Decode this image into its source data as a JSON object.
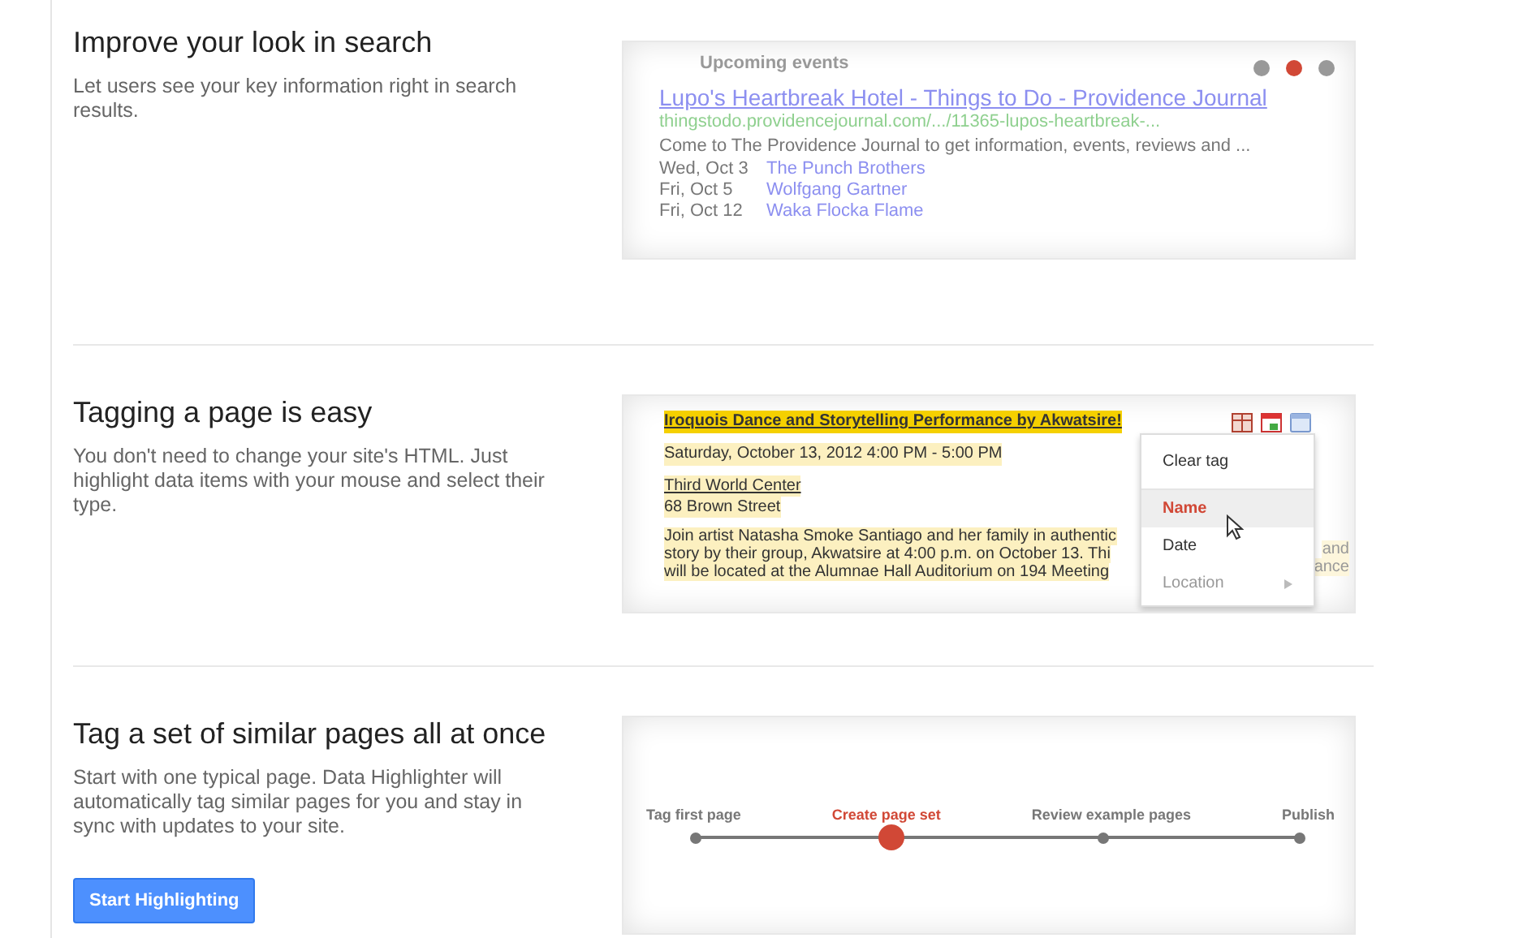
{
  "sections": [
    {
      "kind": "search",
      "heading": "Improve your look in search",
      "description": "Let users see your key information right in search results.",
      "panel": {
        "header": "Upcoming events",
        "title": "Lupo's Heartbreak Hotel - Things to Do - Providence Journal",
        "url": "thingstodo.providencejournal.com/.../11365-lupos-heartbreak-...",
        "snippet": "Come to The Providence Journal to get information, events, reviews and ...",
        "events": [
          {
            "date": "Wed, Oct 3",
            "name": "The Punch Brothers"
          },
          {
            "date": "Fri, Oct 5",
            "name": "Wolfgang Gartner"
          },
          {
            "date": "Fri, Oct 12",
            "name": "Waka Flocka Flame"
          }
        ],
        "dots": [
          {
            "selected": false
          },
          {
            "selected": true
          },
          {
            "selected": false
          }
        ]
      }
    },
    {
      "kind": "tagging",
      "heading": "Tagging a page is easy",
      "description": "You don't need to change your site's HTML. Just highlight data items with your mouse and select their type.",
      "panel": {
        "event_title": "Iroquois Dance and Storytelling Performance by Akwatsire!",
        "datetime": "Saturday, October 13, 2012 4:00 PM - 5:00 PM",
        "venue": "Third World Center",
        "street": "68 Brown Street",
        "body_lines": [
          "Join artist Natasha Smoke Santiago and her family in authentic",
          "story by their group, Akwatsire at 4:00 p.m. on October 13. Thi",
          "will be located at the Alumnae Hall Auditorium on 194 Meeting"
        ],
        "body_fragments": [
          "and",
          "ance"
        ],
        "menu": [
          {
            "label": "Clear tag",
            "selected": false,
            "disabled": false,
            "submenu": false
          },
          {
            "label": "Name",
            "selected": true,
            "disabled": false,
            "submenu": false
          },
          {
            "label": "Date",
            "selected": false,
            "disabled": false,
            "submenu": false
          },
          {
            "label": "Location",
            "selected": false,
            "disabled": true,
            "submenu": true
          }
        ]
      }
    },
    {
      "kind": "steps",
      "heading": "Tag a set of similar pages all at once",
      "description": "Start with one typical page. Data Highlighter will automatically tag similar pages for you and stay in sync with updates to your site.",
      "button": "Start Highlighting",
      "panel": {
        "steps": [
          {
            "label": "Tag first page",
            "selected": false
          },
          {
            "label": "Create page set",
            "selected": true
          },
          {
            "label": "Review example pages",
            "selected": false
          },
          {
            "label": "Publish",
            "selected": false
          }
        ]
      }
    }
  ]
}
